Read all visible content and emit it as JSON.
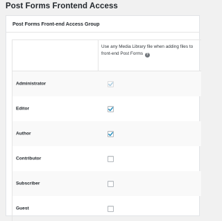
{
  "page": {
    "title": "Post Forms Frontend Access"
  },
  "panel": {
    "title": "Post Forms Front-end Access Group"
  },
  "table": {
    "column_description": "Use any Media Library file when adding files to front-end Post Forms",
    "help_icon": "question-circle-icon",
    "rows": [
      {
        "label": "Administrator",
        "checked": true,
        "disabled": true
      },
      {
        "label": "Editor",
        "checked": true,
        "disabled": false
      },
      {
        "label": "Author",
        "checked": true,
        "disabled": false
      },
      {
        "label": "Contributor",
        "checked": false,
        "disabled": false
      },
      {
        "label": "Subscriber",
        "checked": false,
        "disabled": false
      },
      {
        "label": "Guest",
        "checked": false,
        "disabled": false
      }
    ]
  },
  "colors": {
    "check_active": "#1e8cbe",
    "check_disabled": "#a7cbe0",
    "page_background": "#f1f1f1",
    "panel_background": "#ffffff",
    "row_alt_background": "#f9f9f9"
  }
}
